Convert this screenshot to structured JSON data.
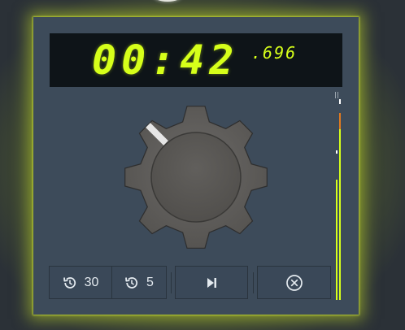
{
  "timer": {
    "main": "00:42",
    "fraction": ".696"
  },
  "controls": {
    "rewind_30_label": "30",
    "rewind_5_label": "5"
  },
  "icons": {
    "rewind_30": "history-icon",
    "rewind_5": "history-icon",
    "skip": "skip-forward-icon",
    "clear": "close-circle-icon"
  },
  "colors": {
    "display_digits": "#d6ff1a",
    "panel": "#3d4b5a",
    "glow": "#c8e128",
    "meter_accent": "#e07a20"
  }
}
